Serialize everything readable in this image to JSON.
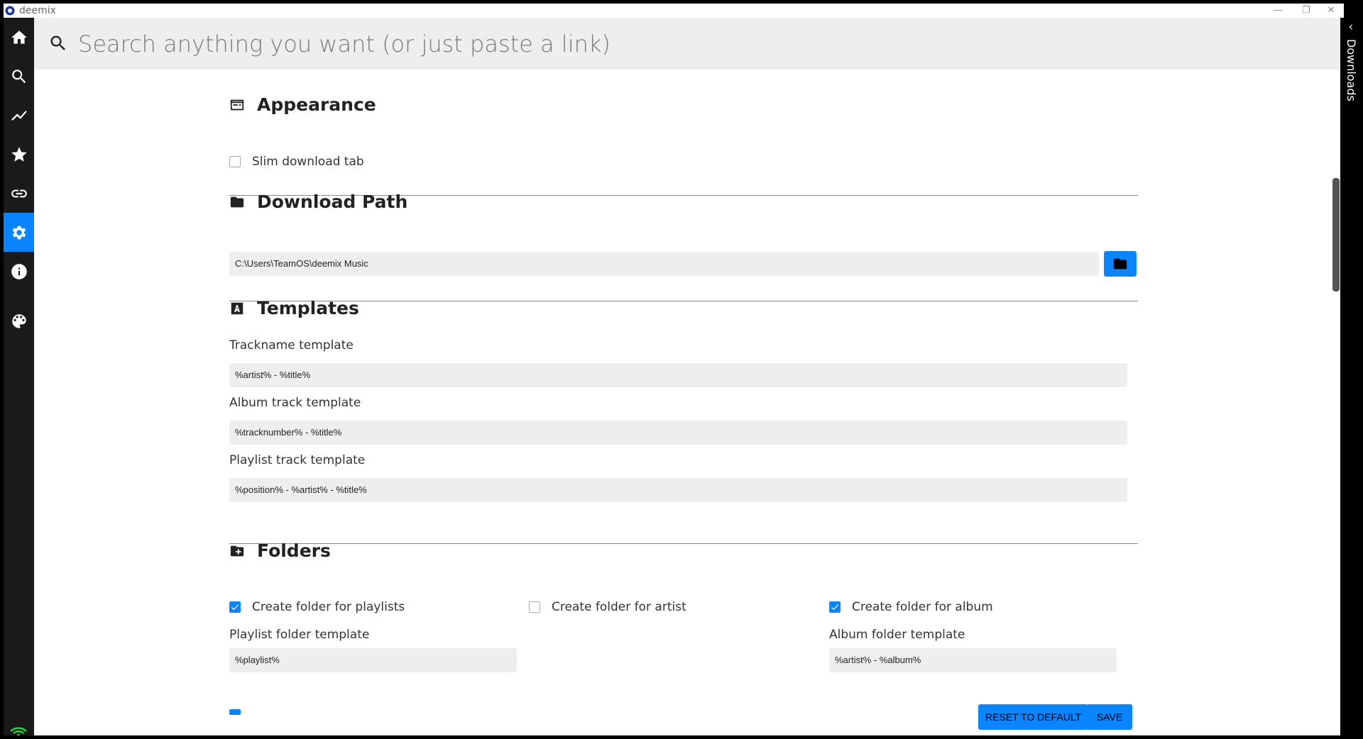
{
  "app": {
    "title": "deemix"
  },
  "window": {
    "minimize": "—",
    "restore": "❐",
    "close": "✕"
  },
  "sidebar": {
    "items": [
      {
        "name": "home",
        "icon": "home-icon"
      },
      {
        "name": "search",
        "icon": "search-icon"
      },
      {
        "name": "charts",
        "icon": "trending-icon"
      },
      {
        "name": "favorites",
        "icon": "star-icon"
      },
      {
        "name": "link-analyzer",
        "icon": "link-icon"
      },
      {
        "name": "settings",
        "icon": "gear-icon",
        "active": true
      },
      {
        "name": "about",
        "icon": "info-icon"
      },
      {
        "name": "theme",
        "icon": "palette-icon"
      }
    ],
    "active_color": "#0b84ff"
  },
  "search": {
    "placeholder": "Search anything you want (or just paste a link)",
    "value": ""
  },
  "appearance": {
    "title": "Appearance",
    "slim_download_tab": {
      "label": "Slim download tab",
      "checked": false
    }
  },
  "download_path": {
    "title": "Download Path",
    "value": "C:\\Users\\TeamOS\\deemix Music"
  },
  "templates": {
    "title": "Templates",
    "trackname": {
      "label": "Trackname template",
      "value": "%artist% - %title%"
    },
    "album_track": {
      "label": "Album track template",
      "value": "%tracknumber% - %title%"
    },
    "playlist_track": {
      "label": "Playlist track template",
      "value": "%position% - %artist% - %title%"
    }
  },
  "folders": {
    "title": "Folders",
    "create_playlist_folder": {
      "label": "Create folder for playlists",
      "checked": true
    },
    "create_artist_folder": {
      "label": "Create folder for artist",
      "checked": false
    },
    "create_album_folder": {
      "label": "Create folder for album",
      "checked": true
    },
    "playlist_folder_template": {
      "label": "Playlist folder template",
      "value": "%playlist%"
    },
    "album_folder_template": {
      "label": "Album folder template",
      "value": "%artist% - %album%"
    }
  },
  "actions": {
    "reset": "RESET TO DEFAULT",
    "save": "SAVE"
  },
  "downloads_panel": {
    "label": "Downloads"
  },
  "colors": {
    "accent": "#0b84ff",
    "input_bg": "#eeeeee",
    "sidebar_bg": "#1a1a1a"
  }
}
